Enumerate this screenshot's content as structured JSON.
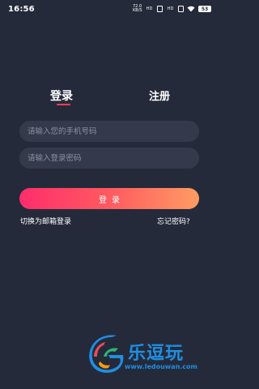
{
  "status_bar": {
    "time": "16:56",
    "net_speed": "72.0 KB/S",
    "signal_left": "HD",
    "signal_right": "HD",
    "battery": "53"
  },
  "tabs": {
    "login": "登录",
    "register": "注册"
  },
  "form": {
    "phone_placeholder": "请输入您的手机号码",
    "password_placeholder": "请输入登录密码",
    "login_button": "登录"
  },
  "links": {
    "switch_email": "切换为邮箱登录",
    "forgot_password": "忘记密码?"
  },
  "watermark": {
    "brand": "乐逗玩",
    "url": "www.ledouwan.com"
  },
  "colors": {
    "background": "#252a3a",
    "input_bg": "#343a4c",
    "accent": "#ff3d55",
    "gradient_start": "#ff2d6c",
    "gradient_end": "#ff9c62",
    "logo": "#1f8fe3"
  }
}
